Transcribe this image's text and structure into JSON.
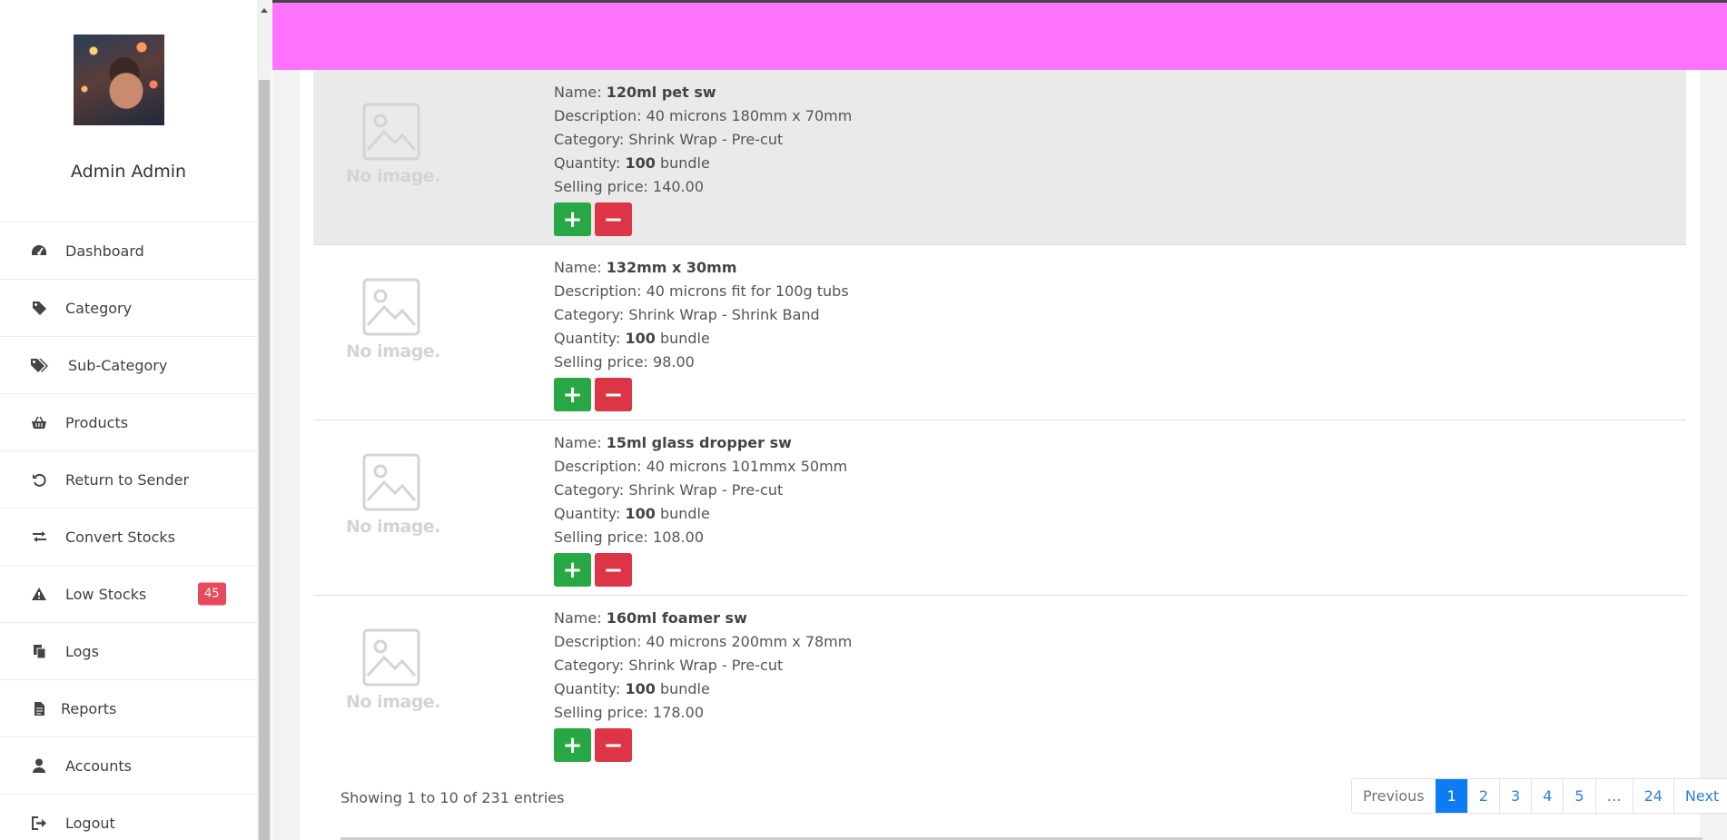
{
  "user": {
    "name": "Admin Admin"
  },
  "sidebar": {
    "items": [
      {
        "label": "Dashboard",
        "icon": "dashboard-icon"
      },
      {
        "label": "Category",
        "icon": "tag-icon"
      },
      {
        "label": "Sub-Category",
        "icon": "tags-icon"
      },
      {
        "label": "Products",
        "icon": "basket-icon"
      },
      {
        "label": "Return to Sender",
        "icon": "undo-icon"
      },
      {
        "label": "Convert Stocks",
        "icon": "exchange-icon"
      },
      {
        "label": "Low Stocks",
        "icon": "warning-icon",
        "badge": "45"
      },
      {
        "label": "Logs",
        "icon": "copy-icon"
      },
      {
        "label": "Reports",
        "icon": "file-icon"
      },
      {
        "label": "Accounts",
        "icon": "user-icon"
      },
      {
        "label": "Logout",
        "icon": "sign-out-icon"
      }
    ]
  },
  "labels": {
    "name": "Name: ",
    "description": "Description: ",
    "category": "Category: ",
    "quantity": "Quantity: ",
    "selling_price": "Selling price: ",
    "no_image": "No image.",
    "add_symbol": "+",
    "remove_symbol": "−"
  },
  "products": [
    {
      "name": "120ml pet sw",
      "description": "40 microns 180mm x 70mm",
      "category": "Shrink Wrap - Pre-cut",
      "quantity": "100",
      "unit": " bundle",
      "price": "140.00"
    },
    {
      "name": "132mm x 30mm",
      "description": "40 microns fit for 100g tubs",
      "category": "Shrink Wrap - Shrink Band",
      "quantity": "100",
      "unit": " bundle",
      "price": "98.00"
    },
    {
      "name": "15ml glass dropper sw",
      "description": "40 microns 101mmx 50mm",
      "category": "Shrink Wrap - Pre-cut",
      "quantity": "100",
      "unit": " bundle",
      "price": "108.00"
    },
    {
      "name": "160ml foamer sw",
      "description": "40 microns 200mm x 78mm",
      "category": "Shrink Wrap - Pre-cut",
      "quantity": "100",
      "unit": " bundle",
      "price": "178.00"
    }
  ],
  "table_info": "Showing 1 to 10 of 231 entries",
  "pagination": {
    "previous": "Previous",
    "pages": [
      "1",
      "2",
      "3",
      "4",
      "5",
      "…",
      "24"
    ],
    "active": "1",
    "next": "Next"
  },
  "colors": {
    "topbar": "#ff73ff",
    "add": "#27a844",
    "remove": "#dc3545",
    "badge": "#e74a5a",
    "active_page": "#0d7cf2"
  }
}
